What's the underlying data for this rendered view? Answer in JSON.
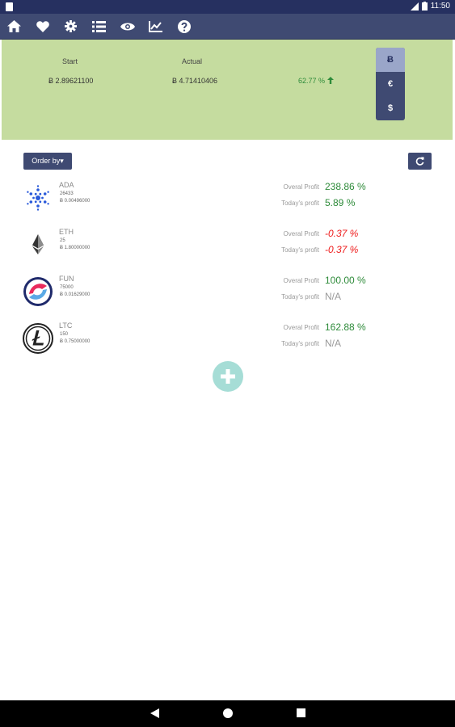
{
  "status_bar": {
    "time": "11:50"
  },
  "toolbar": {
    "icons": [
      "home-icon",
      "heart-icon",
      "gear-icon",
      "list-icon",
      "eye-icon",
      "chart-icon",
      "help-icon"
    ]
  },
  "summary": {
    "start_label": "Start",
    "actual_label": "Actual",
    "start_value": "Ƀ 2.89621100",
    "actual_value": "Ƀ 4.71410406",
    "change": "62.77 %",
    "currencies": [
      "Ƀ",
      "€",
      "$"
    ],
    "active_currency": "Ƀ"
  },
  "controls": {
    "order_by": "Order by▾"
  },
  "labels": {
    "overall": "Overal Profit",
    "today": "Today's profit"
  },
  "coins": [
    {
      "symbol": "ADA",
      "quantity": "26433",
      "btc_price": "Ƀ 0.00496000",
      "overall": "238.86 %",
      "today": "5.89 %",
      "overall_state": "pos",
      "today_state": "pos"
    },
    {
      "symbol": "ETH",
      "quantity": "25",
      "btc_price": "Ƀ 1.80000000",
      "overall": "-0.37 %",
      "today": "-0.37 %",
      "overall_state": "neg",
      "today_state": "neg"
    },
    {
      "symbol": "FUN",
      "quantity": "75000",
      "btc_price": "Ƀ 0.01629000",
      "overall": "100.00 %",
      "today": "N/A",
      "overall_state": "pos",
      "today_state": "na"
    },
    {
      "symbol": "LTC",
      "quantity": "150",
      "btc_price": "Ƀ 0.75000000",
      "overall": "162.88 %",
      "today": "N/A",
      "overall_state": "pos",
      "today_state": "na"
    }
  ],
  "colors": {
    "toolbar": "#3f4a72",
    "statusbar": "#263060",
    "summary_bg": "#c5dc9f",
    "positive": "#2e8b3a",
    "negative": "#ee1c1c",
    "fab": "#a6ddd6"
  }
}
